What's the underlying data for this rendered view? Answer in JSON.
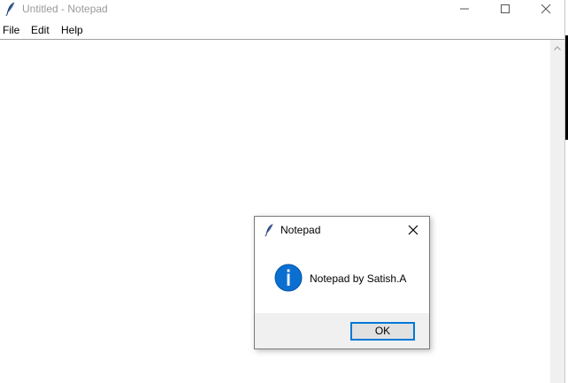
{
  "window": {
    "title": "Untitled - Notepad",
    "icon": "feather-quill-icon"
  },
  "menubar": {
    "items": [
      {
        "label": "File"
      },
      {
        "label": "Edit"
      },
      {
        "label": "Help"
      }
    ]
  },
  "editor": {
    "content": ""
  },
  "dialog": {
    "title": "Notepad",
    "icon": "feather-quill-icon",
    "message": "Notepad by Satish.A",
    "message_icon": "info-icon",
    "ok_label": "OK",
    "accent_color": "#0078d7",
    "info_color": "#0a6fd0"
  }
}
